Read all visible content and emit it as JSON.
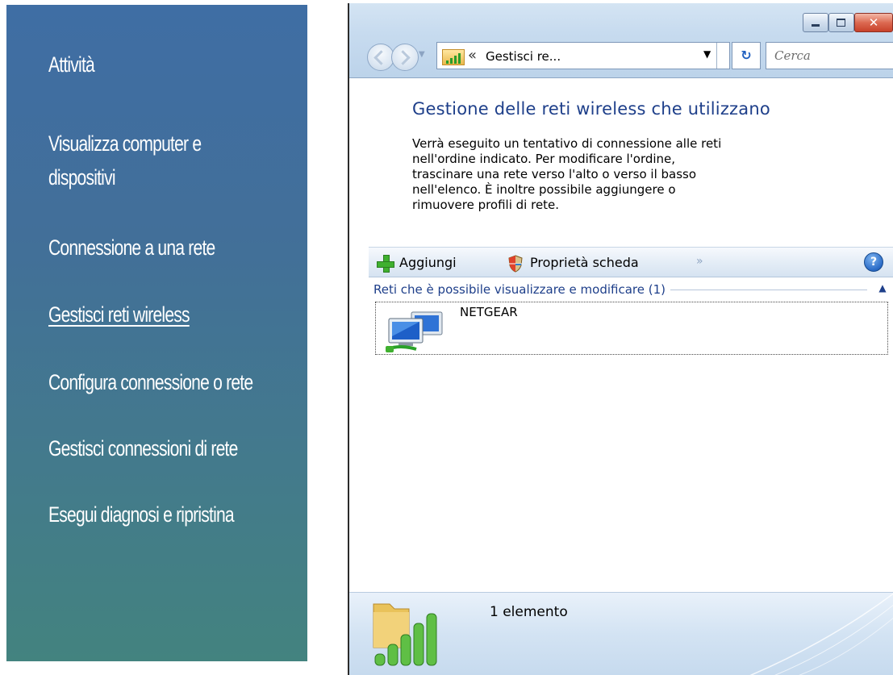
{
  "task_panel": {
    "items": [
      {
        "label": "Attività",
        "link": false
      },
      {
        "label": "Visualizza computer e",
        "link": false
      },
      {
        "label": "dispositivi",
        "link": false
      },
      {
        "label": "Connessione a una rete",
        "link": false
      },
      {
        "label": "Gestisci reti wireless",
        "link": true
      },
      {
        "label": "Configura connessione o rete",
        "link": false
      },
      {
        "label": "Gestisci connessioni di rete",
        "link": false
      },
      {
        "label": "Esegui diagnosi e ripristina",
        "link": false
      }
    ]
  },
  "window": {
    "address": {
      "separator": "«",
      "text": "Gestisci re...",
      "dropdown_glyph": "▼",
      "refresh_glyph": "↻"
    },
    "search": {
      "placeholder": "Cerca"
    },
    "caption": {
      "close_glyph": "✕"
    },
    "content": {
      "title": "Gestione delle reti wireless che utilizzano",
      "description": "Verrà eseguito un tentativo di connessione alle reti\nnell'ordine indicato. Per modificare l'ordine,\ntrascinare una rete verso l'alto o verso il basso\nnell'elenco. È inoltre possibile aggiungere o\nrimuovere profili di rete."
    },
    "toolbar": {
      "add_label": "Aggiungi",
      "properties_label": "Proprietà scheda",
      "more_glyph": "»",
      "help_glyph": "?"
    },
    "group": {
      "label": "Reti che è possibile visualizzare e modificare (1)",
      "toggle_glyph": "▲"
    },
    "networks": [
      {
        "name": "NETGEAR"
      }
    ],
    "details": {
      "text": "1 elemento"
    }
  },
  "icons": {
    "add": "plus-icon",
    "properties": "shield-icon",
    "network": "network-computers-icon",
    "details": "wireless-folder-signal-icon"
  },
  "colors": {
    "panel_top": "#3f6ea4",
    "panel_bottom": "#43837f",
    "title_blue": "#1e3f8a",
    "accent_green": "#3fb02f"
  }
}
